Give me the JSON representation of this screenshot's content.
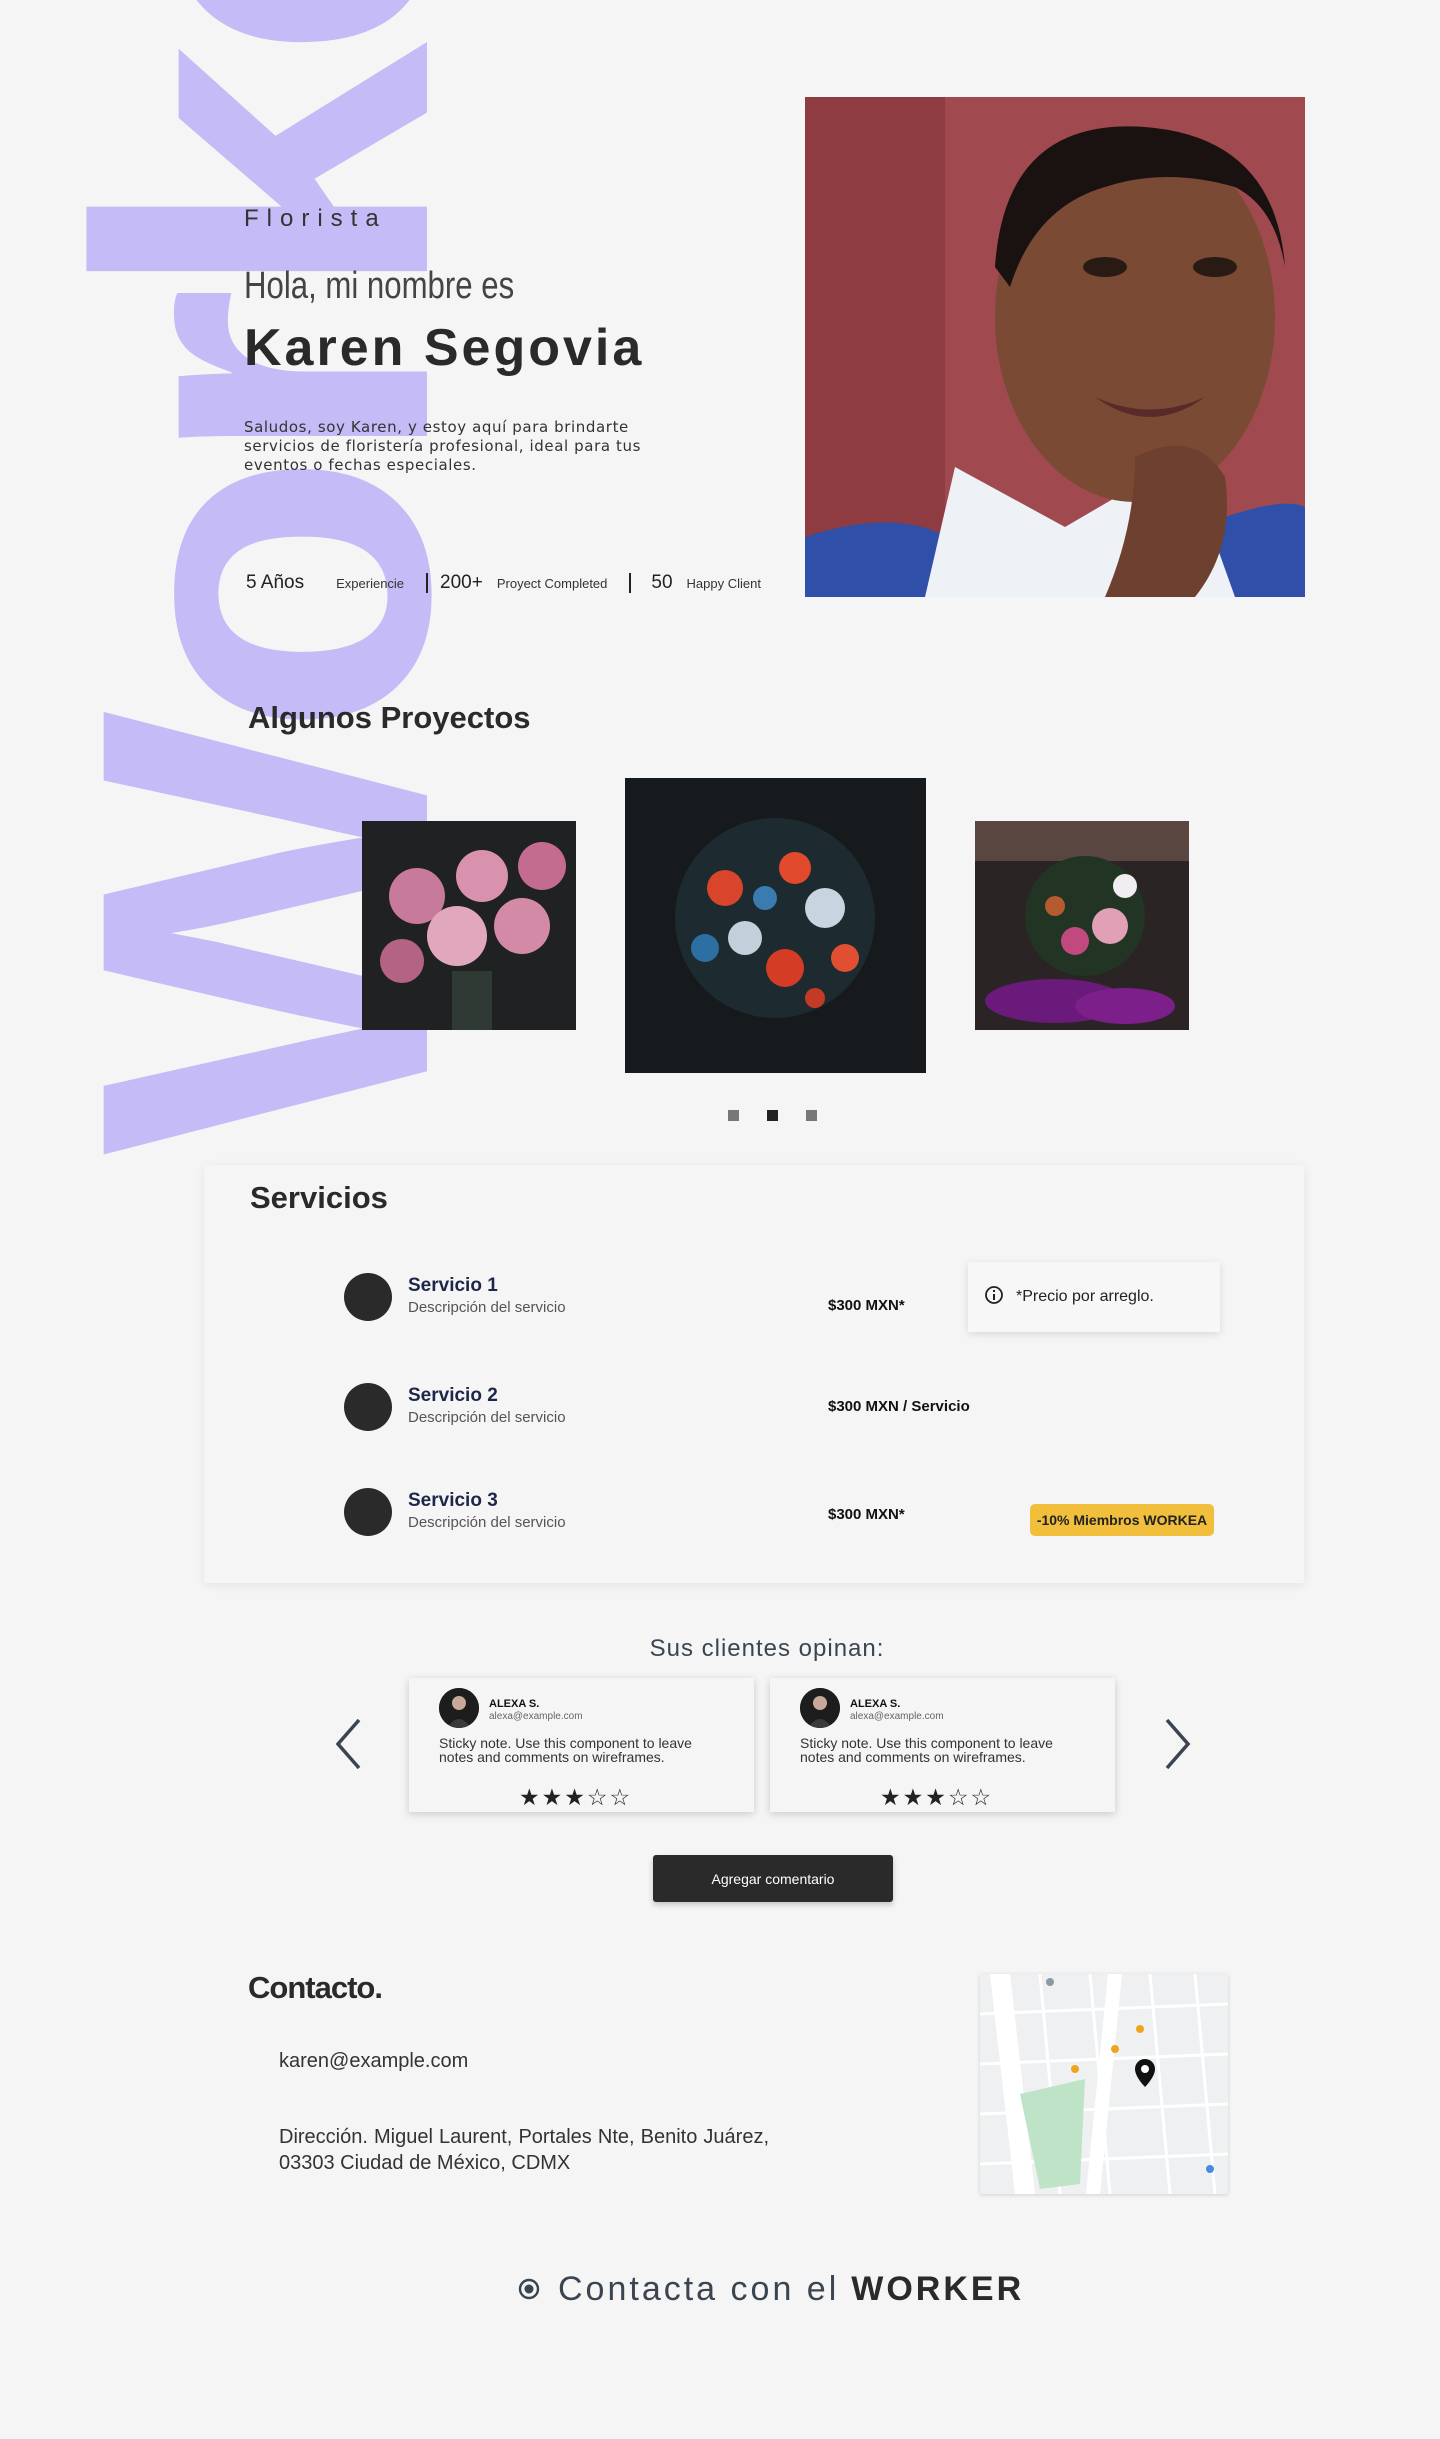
{
  "watermark": "Workea",
  "hero": {
    "kicker": "Florista",
    "greeting": "Hola, mi nombre es",
    "name": "Karen Segovia",
    "description": "Saludos, soy Karen, y estoy aquí para brindarte servicios de floristería profesional, ideal para tus eventos o fechas especiales.",
    "stats": [
      {
        "value": "5 Años",
        "label": "Experiencie"
      },
      {
        "value": "200+",
        "label": "Proyect Completed"
      },
      {
        "value": "50",
        "label": "Happy Client"
      }
    ]
  },
  "projects": {
    "title": "Algunos Proyectos",
    "carousel_dots": 3,
    "active_dot": 2
  },
  "services": {
    "title": "Servicios",
    "items": [
      {
        "name": "Servicio 1",
        "description": "Descripción del servicio",
        "price": "$300 MXN*"
      },
      {
        "name": "Servicio 2",
        "description": "Descripción del servicio",
        "price": "$300 MXN / Servicio"
      },
      {
        "name": "Servicio 3",
        "description": "Descripción del servicio",
        "price": "$300 MXN*"
      }
    ],
    "tooltip": "*Precio por arreglo.",
    "badge": "-10% Miembros WORKEA"
  },
  "reviews": {
    "title": "Sus clientes opinan:",
    "items": [
      {
        "name": "ALEXA S.",
        "email": "alexa@example.com",
        "text": "Sticky note. Use this component to leave notes and comments on wireframes.",
        "rating": 3,
        "max": 5
      },
      {
        "name": "ALEXA S.",
        "email": "alexa@example.com",
        "text": "Sticky note. Use this component to leave notes and comments on wireframes.",
        "rating": 3,
        "max": 5
      }
    ],
    "add_button": "Agregar comentario"
  },
  "contact": {
    "title": "Contacto.",
    "email": "karen@example.com",
    "address": "Dirección. Miguel Laurent, Portales Nte, Benito Juárez, 03303 Ciudad de México, CDMX"
  },
  "cta": {
    "prefix": "Contacta con el",
    "highlight": "WORKER"
  },
  "colors": {
    "background": "#f5f5f5",
    "watermark": "#c4bbf7",
    "dark": "#2a2a2a",
    "badge": "#f2bf3c"
  }
}
